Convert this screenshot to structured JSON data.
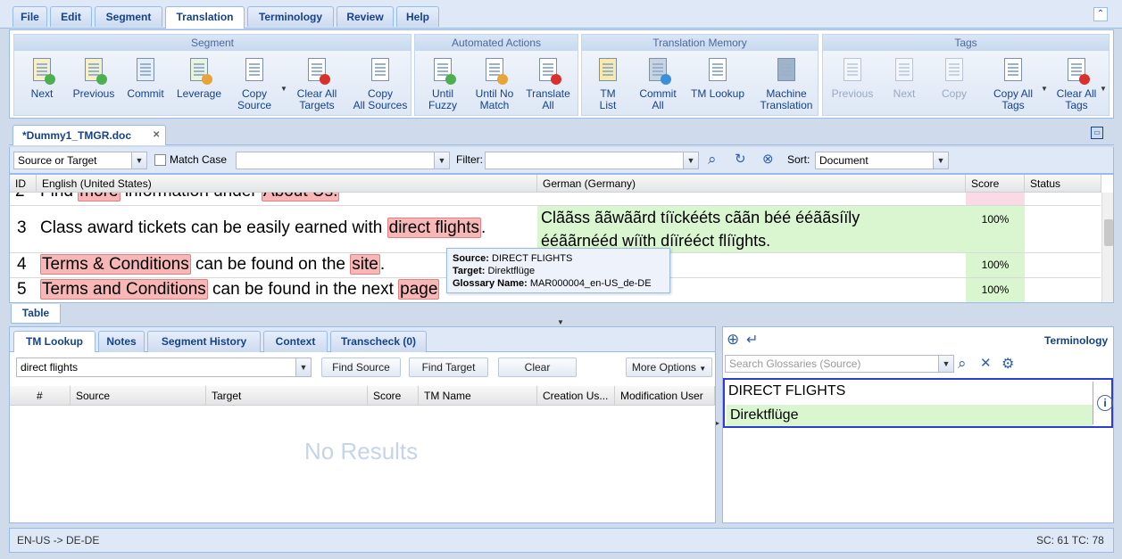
{
  "menu": {
    "tabs": [
      "File",
      "Edit",
      "Segment",
      "Translation",
      "Terminology",
      "Review",
      "Help"
    ]
  },
  "ribbon": {
    "groups": {
      "segment": {
        "title": "Segment",
        "buttons": [
          "Next",
          "Previous",
          "Commit",
          "Leverage",
          "Copy\nSource",
          "Clear All\nTargets",
          "Copy\nAll Sources"
        ]
      },
      "automated": {
        "title": "Automated Actions",
        "buttons": [
          "Until\nFuzzy",
          "Until No\nMatch",
          "Translate\nAll"
        ]
      },
      "tm": {
        "title": "Translation Memory",
        "buttons": [
          "TM\nList",
          "Commit\nAll",
          "TM Lookup",
          "Machine\nTranslation"
        ]
      },
      "tags": {
        "title": "Tags",
        "buttons": [
          "Previous",
          "Next",
          "Copy",
          "Copy All\nTags",
          "Clear All\nTags"
        ]
      }
    }
  },
  "document": {
    "tab_label": "*Dummy1_TMGR.doc"
  },
  "filter": {
    "scope": "Source or Target",
    "match_case_label": "Match Case",
    "search_value": "",
    "filter_label": "Filter:",
    "filter_value": "",
    "sort_label": "Sort:",
    "sort_value": "Document"
  },
  "grid": {
    "headers": {
      "id": "ID",
      "source": "English (United States)",
      "target": "German (Germany)",
      "score": "Score",
      "status": "Status"
    },
    "rows": [
      {
        "id": "2",
        "source_parts": [
          "Find ",
          "more",
          " information under ",
          "About Us."
        ],
        "target": "",
        "score": ""
      },
      {
        "id": "3",
        "source_parts": [
          "Class award tickets can be easily earned with ",
          "direct flights",
          "."
        ],
        "target_line1": "Clããss ããwããrd tíïckééts cããn béé ééããsíïly",
        "target_line2": "ééããrnééd wíïth díïrééct flíïghts.",
        "score": "100%"
      },
      {
        "id": "4",
        "source_parts": [
          "Terms & Conditions",
          " can be found on the ",
          "site",
          "."
        ],
        "target": "",
        "score": "100%"
      },
      {
        "id": "5",
        "source_parts": [
          "Terms and Conditions",
          " can be found in the next ",
          "pa",
          "ge"
        ],
        "target": "",
        "score": "100%"
      }
    ],
    "tooltip": {
      "source_label": "Source:",
      "source_value": "DIRECT FLIGHTS",
      "target_label": "Target:",
      "target_value": "Direktflüge",
      "glossary_label": "Glossary Name:",
      "glossary_value": "MAR000004_en-US_de-DE"
    },
    "table_tab": "Table"
  },
  "lookup": {
    "tabs": [
      "TM Lookup",
      "Notes",
      "Segment History",
      "Context",
      "Transcheck (0)"
    ],
    "query": "direct flights",
    "find_source": "Find Source",
    "find_target": "Find Target",
    "clear": "Clear",
    "more_options": "More Options",
    "columns": [
      "#",
      "Source",
      "Target",
      "Score",
      "TM Name",
      "Creation Us...",
      "Modification User"
    ],
    "empty_text": "No Results"
  },
  "terminology": {
    "title": "Terminology",
    "search_placeholder": "Search Glossaries (Source)",
    "term_source": "DIRECT FLIGHTS",
    "term_target": "Direktflüge"
  },
  "status": {
    "lang_pair": "EN-US -> DE-DE",
    "counts": "SC: 61 TC: 78"
  },
  "colors": {
    "accent": "#15428b",
    "highlight": "#f7b7b7",
    "target_bg": "#d9f6d0"
  }
}
